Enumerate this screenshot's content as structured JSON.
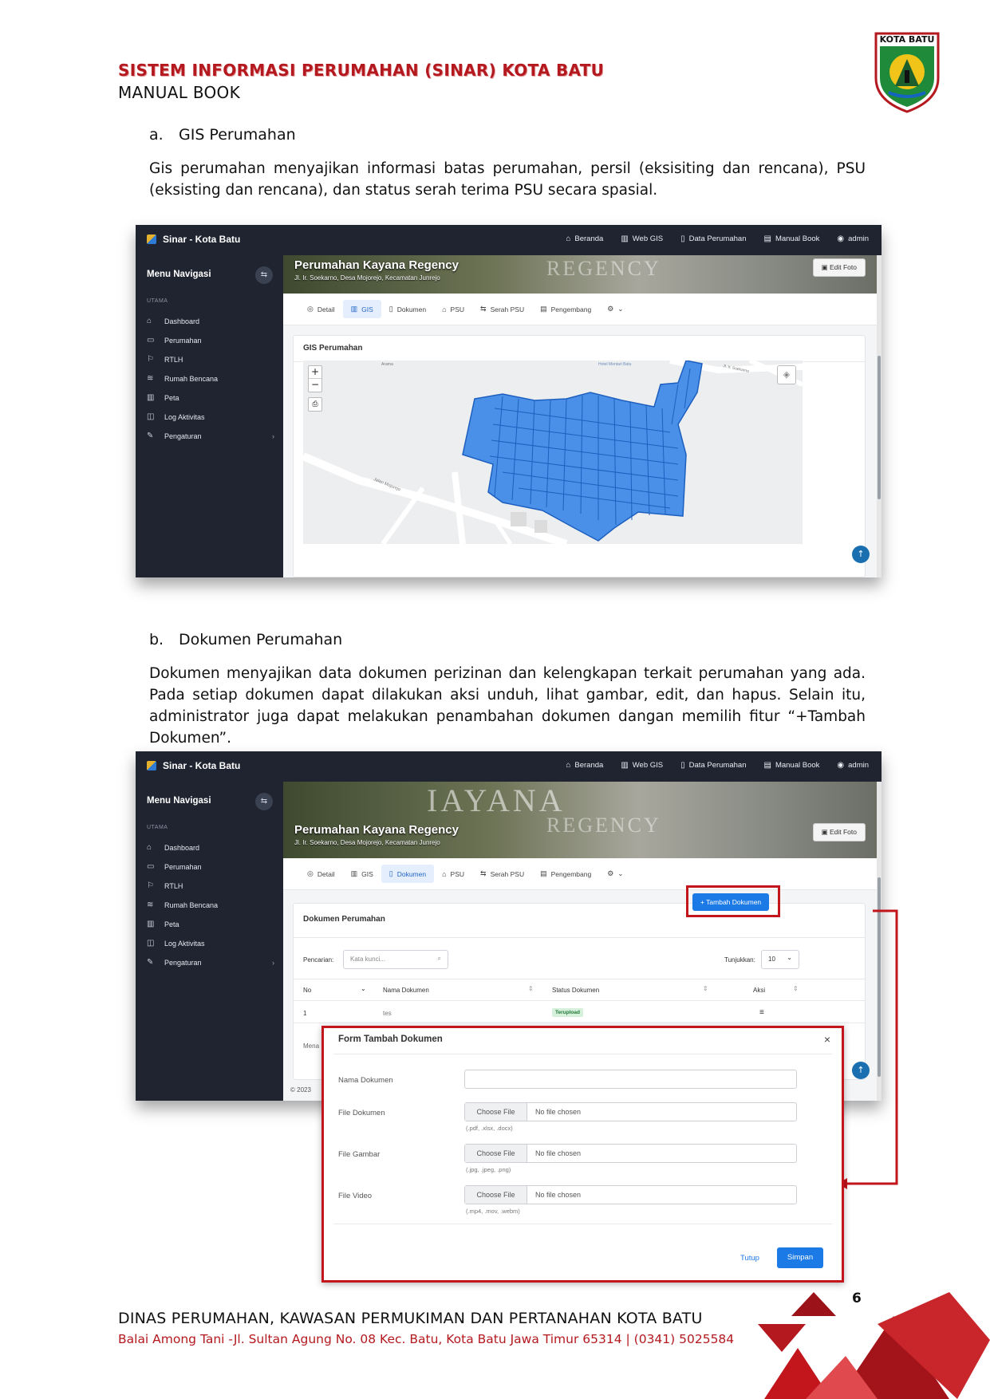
{
  "header": {
    "title": "SISTEM INFORMASI PERUMAHAN (SINAR) KOTA BATU",
    "subtitle": "MANUAL BOOK",
    "logo_text": "KOTA BATU"
  },
  "section_a": {
    "marker": "a.",
    "title": "GIS Perumahan",
    "paragraph": "Gis perumahan menyajikan informasi batas perumahan, persil (eksisiting dan rencana), PSU (eksisting dan rencana), dan status serah terima PSU secara spasial."
  },
  "section_b": {
    "marker": "b.",
    "title": "Dokumen Perumahan",
    "paragraph": "Dokumen menyajikan data dokumen perizinan dan kelengkapan terkait perumahan yang ada. Pada setiap dokumen dapat dilakukan aksi unduh, lihat gambar, edit, dan hapus. Selain itu, administrator juga dapat melakukan penambahan dokumen dangan memilih fitur “+Tambah Dokumen”."
  },
  "app": {
    "brand": "Sinar - Kota Batu",
    "topnav": [
      {
        "icon": "⌂",
        "label": "Beranda"
      },
      {
        "icon": "▥",
        "label": "Web GIS"
      },
      {
        "icon": "▯",
        "label": "Data Perumahan"
      },
      {
        "icon": "▤",
        "label": "Manual Book"
      },
      {
        "icon": "◉",
        "label": "admin"
      }
    ],
    "sidebar_title": "Menu Navigasi",
    "sidebar_section": "UTAMA",
    "sidebar_items": [
      {
        "icon": "⌂",
        "label": "Dashboard"
      },
      {
        "icon": "▭",
        "label": "Perumahan"
      },
      {
        "icon": "⚐",
        "label": "RTLH"
      },
      {
        "icon": "≋",
        "label": "Rumah Bencana"
      },
      {
        "icon": "▥",
        "label": "Peta"
      },
      {
        "icon": "◫",
        "label": "Log Aktivitas"
      },
      {
        "icon": "✎",
        "label": "Pengaturan"
      }
    ],
    "banner_title": "Perumahan Kayana Regency",
    "banner_subtitle": "Jl. Ir. Soekarno, Desa Mojorejo, Kecamatan Junrejo",
    "banner_watermark": "REGENCY",
    "edit_foto": "Edit Foto",
    "tabs": [
      {
        "icon": "◎",
        "label": "Detail"
      },
      {
        "icon": "▥",
        "label": "GIS"
      },
      {
        "icon": "▯",
        "label": "Dokumen"
      },
      {
        "icon": "⌂",
        "label": "PSU"
      },
      {
        "icon": "⇆",
        "label": "Serah PSU"
      },
      {
        "icon": "▤",
        "label": "Pengembang"
      },
      {
        "icon": "⚙",
        "label": "⌄"
      }
    ]
  },
  "gis_panel": {
    "title": "GIS Perumahan",
    "zoom_in": "+",
    "zoom_out": "−",
    "map_labels": [
      "Arama",
      "Hotel Mentari Batu",
      "Jl. Ir. Soekarno",
      "Jalan Mojorejo"
    ]
  },
  "doc_panel": {
    "title": "Dokumen Perumahan",
    "add_button": "+ Tambah Dokumen",
    "search_label": "Pencarian:",
    "search_placeholder": "Kata kunci...",
    "show_label": "Tunjukkan:",
    "show_value": "10",
    "columns": [
      "No",
      "Nama Dokumen",
      "Status Dokumen",
      "Aksi"
    ],
    "rows": [
      {
        "no": "1",
        "nama": "tes",
        "status": "Terupload",
        "aksi": "≡"
      }
    ],
    "footer_partial": "Mena",
    "copyright_partial": "© 2023"
  },
  "modal": {
    "title": "Form Tambah Dokumen",
    "close": "×",
    "fields": [
      {
        "label": "Nama Dokumen"
      },
      {
        "label": "File Dokumen",
        "button": "Choose File",
        "status": "No file chosen",
        "hint": "(.pdf, .xlsx, .docx)"
      },
      {
        "label": "File Gambar",
        "button": "Choose File",
        "status": "No file chosen",
        "hint": "(.jpg, .jpeg, .png)"
      },
      {
        "label": "File Video",
        "button": "Choose File",
        "status": "No file chosen",
        "hint": "(.mp4, .mov, .webm)"
      }
    ],
    "cancel": "Tutup",
    "submit": "Simpan"
  },
  "footer": {
    "page_number": "6",
    "org": "DINAS PERUMAHAN, KAWASAN PERMUKIMAN DAN PERTANAHAN KOTA BATU",
    "address": "Balai Among Tani -Jl. Sultan Agung No. 08 Kec. Batu, Kota Batu Jawa Timur 65314 | (0341) 5025584"
  },
  "colors": {
    "accent_red": "#b3191f",
    "primary_blue": "#1c7ae6",
    "sidebar_dark": "#1f2430"
  }
}
